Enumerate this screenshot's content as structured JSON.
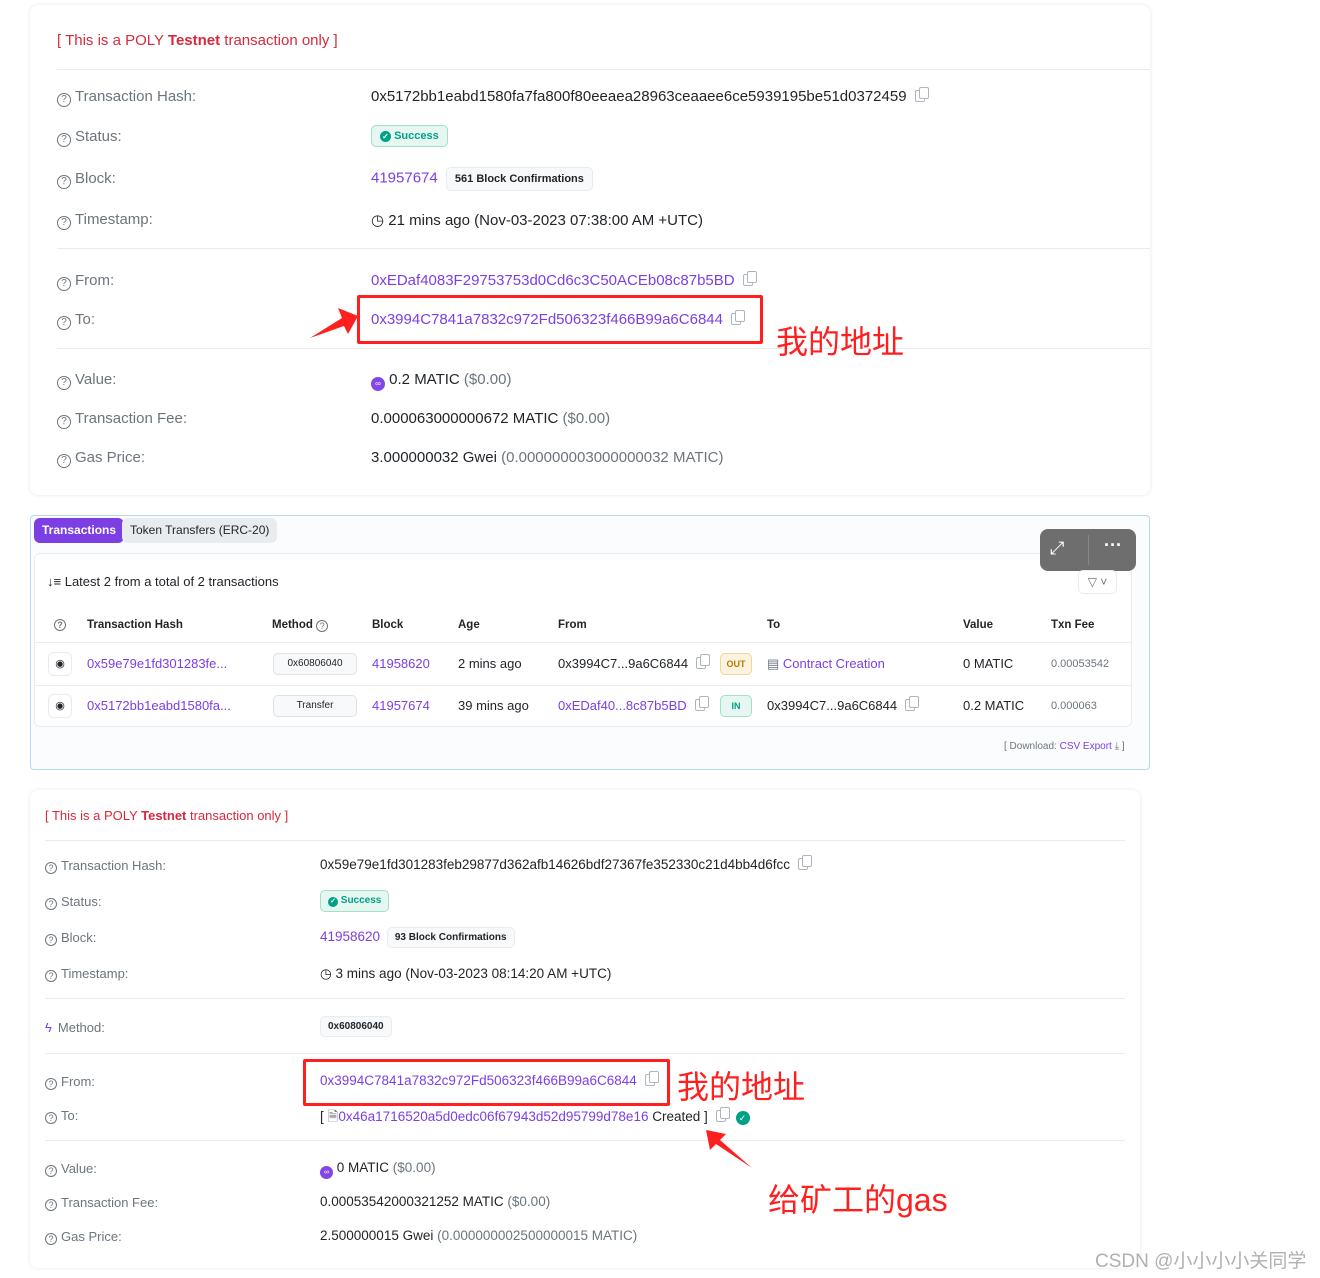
{
  "tx1": {
    "banner": {
      "prefix": "[ This is a POLY ",
      "bold": "Testnet",
      "suffix": " transaction only ]"
    },
    "labels": {
      "hash": "Transaction Hash:",
      "status": "Status:",
      "block": "Block:",
      "timestamp": "Timestamp:",
      "from": "From:",
      "to": "To:",
      "value": "Value:",
      "fee": "Transaction Fee:",
      "gas": "Gas Price:"
    },
    "hash": "0x5172bb1eabd1580fa7fa800f80eeaea28963ceaaee6ce5939195be51d0372459",
    "status": "Success",
    "block": "41957674",
    "confirmations": "561 Block Confirmations",
    "timestamp": "21 mins ago (Nov-03-2023 07:38:00 AM +UTC)",
    "from": "0xEDaf4083F29753753d0Cd6c3C50ACEb08c87b5BD",
    "to": "0x3994C7841a7832c972Fd506323f466B99a6C6844",
    "value": "0.2 MATIC",
    "value_usd": "($0.00)",
    "fee": "0.000063000000672 MATIC",
    "fee_usd": "($0.00)",
    "gas": "3.000000032 Gwei",
    "gas_matic": "(0.000000003000000032 MATIC)"
  },
  "list": {
    "tabs": [
      "Transactions",
      "Token Transfers (ERC-20)"
    ],
    "summary": "Latest 2 from a total of 2 transactions",
    "columns": [
      "Transaction Hash",
      "Method",
      "Block",
      "Age",
      "From",
      "To",
      "Value",
      "Txn Fee"
    ],
    "rows": [
      {
        "hash": "0x59e79e1fd301283fe...",
        "method": "0x60806040",
        "block": "41958620",
        "age": "2 mins ago",
        "from": "0x3994C7...9a6C6844",
        "dir": "OUT",
        "to": "Contract Creation",
        "value": "0 MATIC",
        "fee": "0.00053542"
      },
      {
        "hash": "0x5172bb1eabd1580fa...",
        "method": "Transfer",
        "block": "41957674",
        "age": "39 mins ago",
        "from": "0xEDaf40...8c87b5BD",
        "dir": "IN",
        "to": "0x3994C7...9a6C6844",
        "value": "0.2 MATIC",
        "fee": "0.000063"
      }
    ],
    "download_prefix": "[ Download: ",
    "download_link": "CSV Export",
    "download_suffix": " ]"
  },
  "tx2": {
    "banner": {
      "prefix": "[ This is a POLY ",
      "bold": "Testnet",
      "suffix": " transaction only ]"
    },
    "labels": {
      "hash": "Transaction Hash:",
      "status": "Status:",
      "block": "Block:",
      "timestamp": "Timestamp:",
      "method": "Method:",
      "from": "From:",
      "to": "To:",
      "value": "Value:",
      "fee": "Transaction Fee:",
      "gas": "Gas Price:"
    },
    "hash": "0x59e79e1fd301283feb29877d362afb14626bdf27367fe352330c21d4bb4d6fcc",
    "status": "Success",
    "block": "41958620",
    "confirmations": "93 Block Confirmations",
    "timestamp": "3 mins ago (Nov-03-2023 08:14:20 AM +UTC)",
    "method": "0x60806040",
    "from": "0x3994C7841a7832c972Fd506323f466B99a6C6844",
    "to_contract": "0x46a1716520a5d0edc06f67943d52d95799d78e16",
    "to_open": "[",
    "to_suffix": "Created ]",
    "value": "0 MATIC",
    "value_usd": "($0.00)",
    "fee": "0.00053542000321252 MATIC",
    "fee_usd": "($0.00)",
    "gas": "2.500000015 Gwei",
    "gas_matic": "(0.000000002500000015 MATIC)"
  },
  "annotations": {
    "my_address": "我的地址",
    "gas_to_miner": "给矿工的gas"
  },
  "watermark": "CSDN @小小小小关同学",
  "colors": {
    "accent": "#7b3fe4",
    "success": "#00a186",
    "red_annotation": "#ff1f1f",
    "testnet": "#d6293e"
  }
}
